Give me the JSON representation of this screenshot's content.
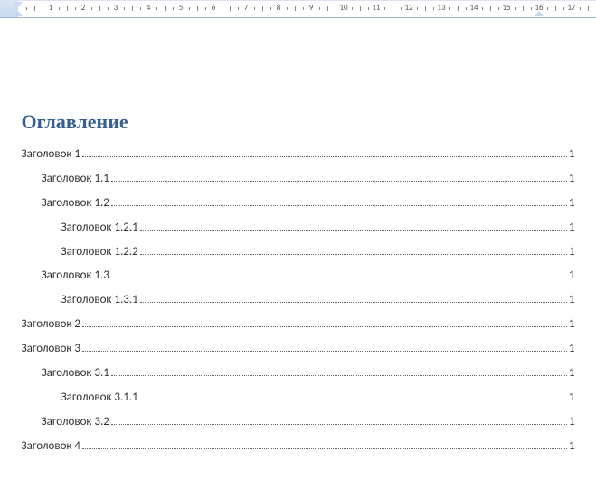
{
  "ruler": {
    "units_visible": 18,
    "indent_left_cm": 0,
    "indent_right_cm": 16
  },
  "toc": {
    "title": "Оглавление",
    "entries": [
      {
        "level": 1,
        "text": "Заголовок 1",
        "page": "1"
      },
      {
        "level": 2,
        "text": "Заголовок 1.1",
        "page": "1"
      },
      {
        "level": 2,
        "text": "Заголовок 1.2",
        "page": "1"
      },
      {
        "level": 3,
        "text": "Заголовок 1.2.1",
        "page": "1"
      },
      {
        "level": 3,
        "text": "Заголовок 1.2.2",
        "page": "1"
      },
      {
        "level": 2,
        "text": "Заголовок 1.3",
        "page": "1"
      },
      {
        "level": 3,
        "text": "Заголовок 1.3.1",
        "page": "1"
      },
      {
        "level": 1,
        "text": "Заголовок 2",
        "page": "1"
      },
      {
        "level": 1,
        "text": "Заголовок 3",
        "page": "1"
      },
      {
        "level": 2,
        "text": "Заголовок 3.1",
        "page": "1"
      },
      {
        "level": 3,
        "text": "Заголовок 3.1.1",
        "page": "1"
      },
      {
        "level": 2,
        "text": "Заголовок 3.2",
        "page": "1"
      },
      {
        "level": 1,
        "text": "Заголовок 4",
        "page": "1"
      }
    ]
  }
}
